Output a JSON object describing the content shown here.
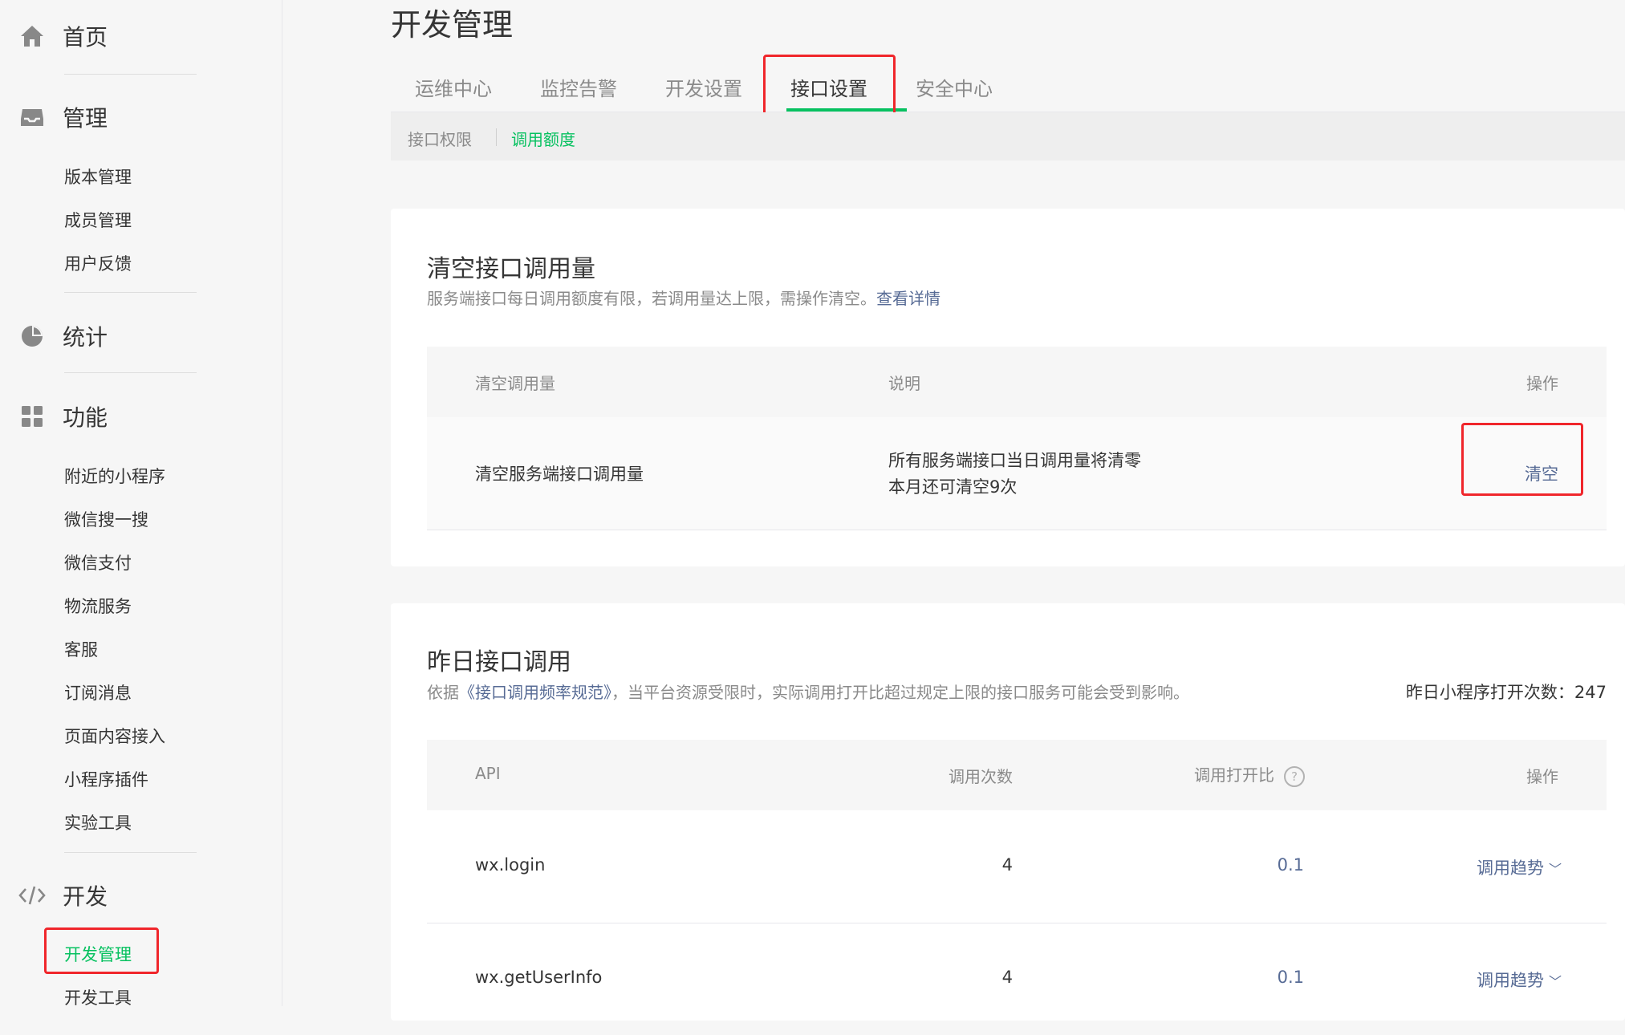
{
  "sidebar": {
    "home": "首页",
    "manage": {
      "title": "管理",
      "items": [
        "版本管理",
        "成员管理",
        "用户反馈"
      ]
    },
    "stats": "统计",
    "features": {
      "title": "功能",
      "items": [
        "附近的小程序",
        "微信搜一搜",
        "微信支付",
        "物流服务",
        "客服",
        "订阅消息",
        "页面内容接入",
        "小程序插件",
        "实验工具"
      ]
    },
    "dev": {
      "title": "开发",
      "items": [
        "开发管理",
        "开发工具"
      ]
    }
  },
  "page": {
    "title": "开发管理",
    "tabs": [
      "运维中心",
      "监控告警",
      "开发设置",
      "接口设置",
      "安全中心"
    ],
    "active_tab": "接口设置",
    "subtabs": [
      "接口权限",
      "调用额度"
    ],
    "active_subtab": "调用额度"
  },
  "clear_card": {
    "title": "清空接口调用量",
    "desc": "服务端接口每日调用额度有限，若调用量达上限，需操作清空。",
    "desc_link": "查看详情",
    "headers": [
      "清空调用量",
      "说明",
      "操作"
    ],
    "row": {
      "name": "清空服务端接口调用量",
      "desc_line1": "所有服务端接口当日调用量将清零",
      "desc_line2": "本月还可清空9次",
      "action": "清空"
    }
  },
  "yesterday_card": {
    "title": "昨日接口调用",
    "desc_prefix": "依据",
    "desc_link": "《接口调用频率规范》",
    "desc_suffix": "，当平台资源受限时，实际调用打开比超过规定上限的接口服务可能会受到影响。",
    "open_count_label": "昨日小程序打开次数：",
    "open_count_value": "247",
    "headers": {
      "api": "API",
      "count": "调用次数",
      "ratio": "调用打开比",
      "help": "?",
      "action": "操作"
    },
    "rows": [
      {
        "api": "wx.login",
        "count": "4",
        "ratio": "0.1",
        "action": "调用趋势"
      },
      {
        "api": "wx.getUserInfo",
        "count": "4",
        "ratio": "0.1",
        "action": "调用趋势"
      }
    ]
  },
  "colors": {
    "accent_green": "#07c160",
    "link_blue": "#576b95",
    "highlight_red": "#f0262b"
  }
}
